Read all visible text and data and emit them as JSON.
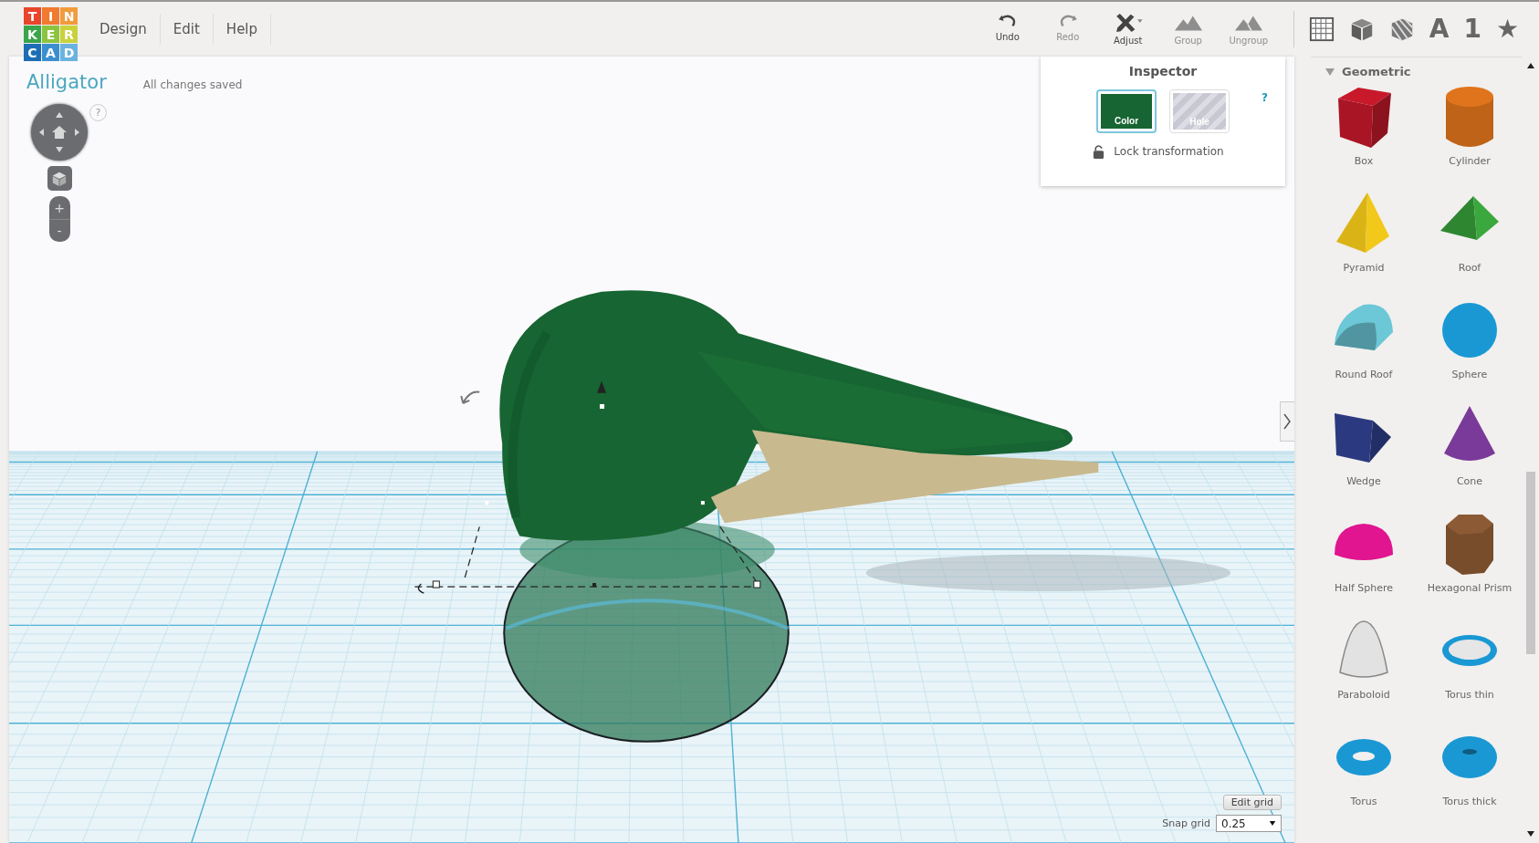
{
  "logo": {
    "letters": [
      "T",
      "I",
      "N",
      "K",
      "E",
      "R",
      "C",
      "A",
      "D"
    ]
  },
  "menu": [
    {
      "label": "Design"
    },
    {
      "label": "Edit"
    },
    {
      "label": "Help"
    }
  ],
  "toolbar": [
    {
      "kind": "undo",
      "label": "Undo",
      "disabled": false
    },
    {
      "kind": "redo",
      "label": "Redo",
      "disabled": true
    },
    {
      "kind": "adjust",
      "label": "Adjust",
      "disabled": false
    },
    {
      "kind": "group",
      "label": "Group",
      "disabled": true
    },
    {
      "kind": "ungroup",
      "label": "Ungroup",
      "disabled": true
    }
  ],
  "view_tools": [
    {
      "kind": "grid"
    },
    {
      "kind": "box"
    },
    {
      "kind": "hole-box"
    },
    {
      "kind": "glyph",
      "text": "A"
    },
    {
      "kind": "glyph",
      "text": "1"
    },
    {
      "kind": "glyph",
      "text": "★"
    }
  ],
  "design": {
    "title": "Alligator",
    "save_status": "All changes saved",
    "view_help": "?",
    "zoom_in": "+",
    "zoom_out": "-"
  },
  "inspector": {
    "title": "Inspector",
    "help": "?",
    "modes": [
      {
        "kind": "color",
        "label": "Color",
        "selected": true
      },
      {
        "kind": "hole",
        "label": "Hole",
        "selected": false
      }
    ],
    "lock": {
      "label": "Lock transformation",
      "locked": false
    }
  },
  "grid_controls": {
    "edit_button": "Edit grid",
    "snap_label": "Snap grid",
    "snap_value": "0.25"
  },
  "library": {
    "category": "Geometric",
    "expanded": true,
    "shapes": [
      {
        "kind": "box",
        "label": "Box",
        "color": "#c8192b"
      },
      {
        "kind": "cylinder",
        "label": "Cylinder",
        "color": "#e0741c"
      },
      {
        "kind": "pyramid",
        "label": "Pyramid",
        "color": "#f2c81a"
      },
      {
        "kind": "roof",
        "label": "Roof",
        "color": "#3aa83d"
      },
      {
        "kind": "round-roof",
        "label": "Round Roof",
        "color": "#6cc7d6"
      },
      {
        "kind": "sphere",
        "label": "Sphere",
        "color": "#1a98d4"
      },
      {
        "kind": "wedge",
        "label": "Wedge",
        "color": "#2b3a80"
      },
      {
        "kind": "cone",
        "label": "Cone",
        "color": "#7a3a9a"
      },
      {
        "kind": "half-sphere",
        "label": "Half Sphere",
        "color": "#e0158f"
      },
      {
        "kind": "hex-prism",
        "label": "Hexagonal Prism",
        "color": "#8c5a34"
      },
      {
        "kind": "paraboloid",
        "label": "Paraboloid",
        "color": "#e2e2e2"
      },
      {
        "kind": "torus-thin",
        "label": "Torus thin",
        "color": "#1a98d4"
      },
      {
        "kind": "torus",
        "label": "Torus",
        "color": "#1a98d4"
      },
      {
        "kind": "torus-thick",
        "label": "Torus thick",
        "color": "#1a98d4"
      }
    ]
  }
}
